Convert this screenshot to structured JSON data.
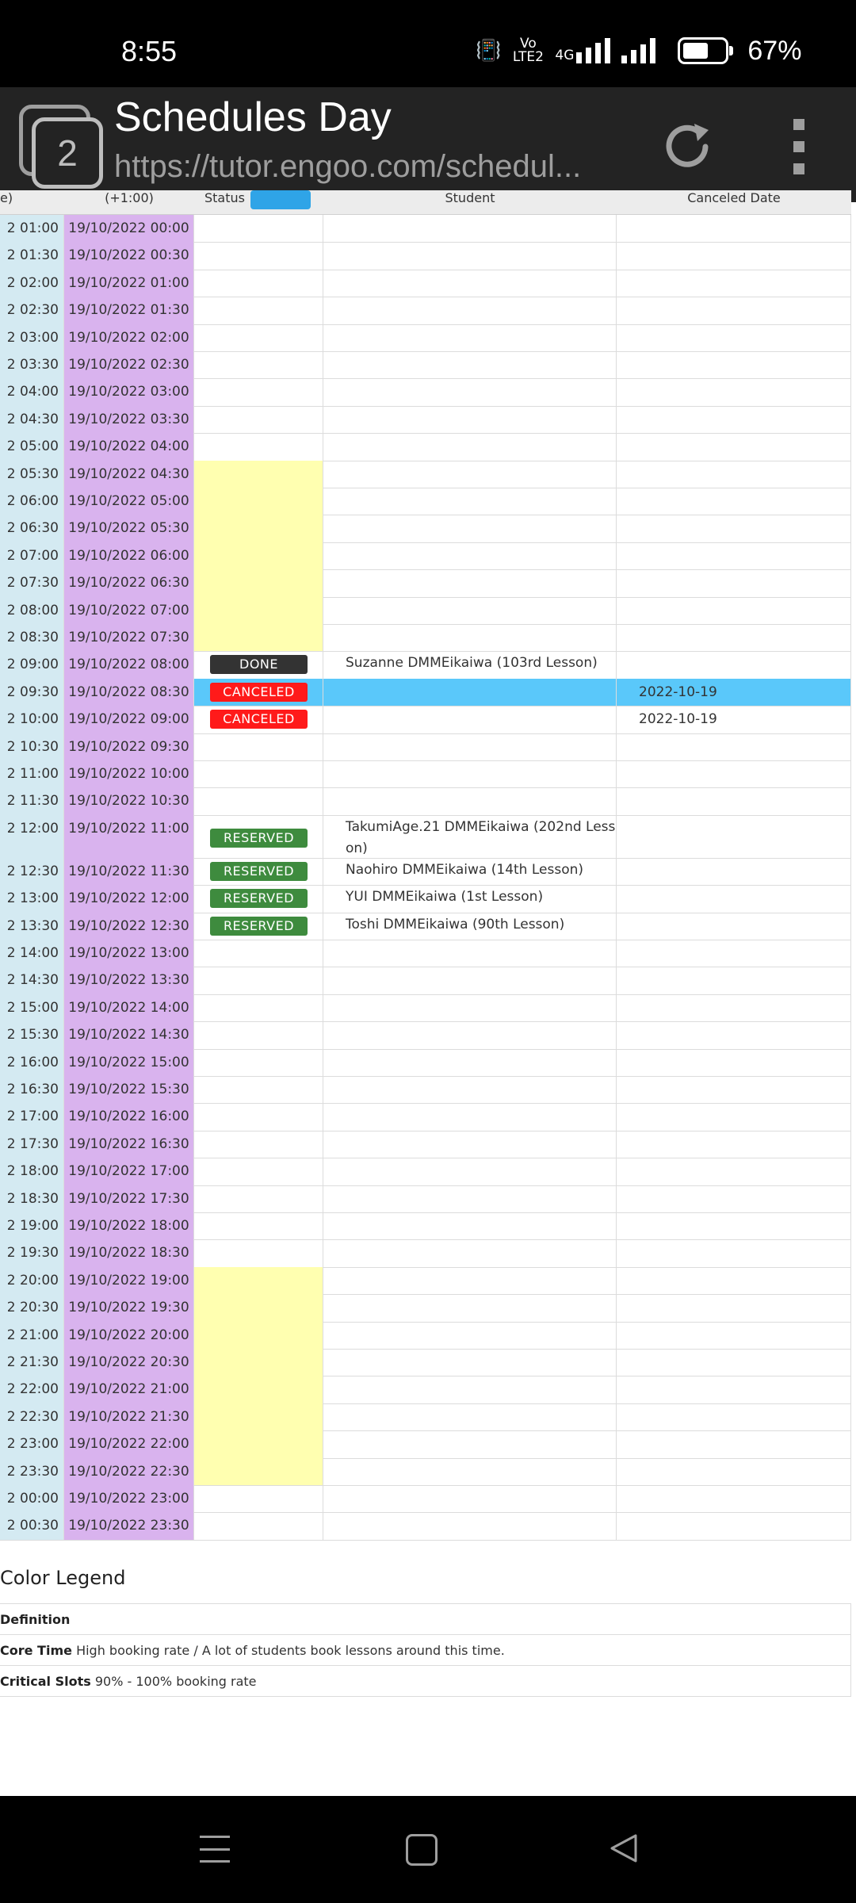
{
  "status_bar": {
    "time": "8:55",
    "volte": "Vo LTE2",
    "network": "4G",
    "battery": "67%",
    "battery_level": 0.67
  },
  "browser": {
    "tab_count": "2",
    "title": "Schedules Day",
    "url": "https://tutor.engoo.com/schedul..."
  },
  "table": {
    "headers": [
      "e)",
      "(+1:00)",
      "Status",
      "Student",
      "Canceled Date"
    ],
    "rows": [
      {
        "local": "2 01:00",
        "jst": "19/10/2022 00:00",
        "core": false,
        "status": "",
        "student": "",
        "canceled": "",
        "highlight": false
      },
      {
        "local": "2 01:30",
        "jst": "19/10/2022 00:30",
        "core": false,
        "status": "",
        "student": "",
        "canceled": "",
        "highlight": false
      },
      {
        "local": "2 02:00",
        "jst": "19/10/2022 01:00",
        "core": false,
        "status": "",
        "student": "",
        "canceled": "",
        "highlight": false
      },
      {
        "local": "2 02:30",
        "jst": "19/10/2022 01:30",
        "core": false,
        "status": "",
        "student": "",
        "canceled": "",
        "highlight": false
      },
      {
        "local": "2 03:00",
        "jst": "19/10/2022 02:00",
        "core": false,
        "status": "",
        "student": "",
        "canceled": "",
        "highlight": false
      },
      {
        "local": "2 03:30",
        "jst": "19/10/2022 02:30",
        "core": false,
        "status": "",
        "student": "",
        "canceled": "",
        "highlight": false
      },
      {
        "local": "2 04:00",
        "jst": "19/10/2022 03:00",
        "core": false,
        "status": "",
        "student": "",
        "canceled": "",
        "highlight": false
      },
      {
        "local": "2 04:30",
        "jst": "19/10/2022 03:30",
        "core": false,
        "status": "",
        "student": "",
        "canceled": "",
        "highlight": false
      },
      {
        "local": "2 05:00",
        "jst": "19/10/2022 04:00",
        "core": false,
        "status": "",
        "student": "",
        "canceled": "",
        "highlight": false
      },
      {
        "local": "2 05:30",
        "jst": "19/10/2022 04:30",
        "core": true,
        "status": "",
        "student": "",
        "canceled": "",
        "highlight": false
      },
      {
        "local": "2 06:00",
        "jst": "19/10/2022 05:00",
        "core": true,
        "status": "",
        "student": "",
        "canceled": "",
        "highlight": false
      },
      {
        "local": "2 06:30",
        "jst": "19/10/2022 05:30",
        "core": true,
        "status": "",
        "student": "",
        "canceled": "",
        "highlight": false
      },
      {
        "local": "2 07:00",
        "jst": "19/10/2022 06:00",
        "core": true,
        "status": "",
        "student": "",
        "canceled": "",
        "highlight": false
      },
      {
        "local": "2 07:30",
        "jst": "19/10/2022 06:30",
        "core": true,
        "status": "",
        "student": "",
        "canceled": "",
        "highlight": false
      },
      {
        "local": "2 08:00",
        "jst": "19/10/2022 07:00",
        "core": true,
        "status": "",
        "student": "",
        "canceled": "",
        "highlight": false
      },
      {
        "local": "2 08:30",
        "jst": "19/10/2022 07:30",
        "core": true,
        "status": "",
        "student": "",
        "canceled": "",
        "highlight": false
      },
      {
        "local": "2 09:00",
        "jst": "19/10/2022 08:00",
        "core": false,
        "status": "DONE",
        "student": "Suzanne DMMEikaiwa (103rd Lesson)",
        "canceled": "",
        "highlight": false
      },
      {
        "local": "2 09:30",
        "jst": "19/10/2022 08:30",
        "core": false,
        "status": "CANCELED",
        "student": "",
        "canceled": "2022-10-19",
        "highlight": true
      },
      {
        "local": "2 10:00",
        "jst": "19/10/2022 09:00",
        "core": false,
        "status": "CANCELED",
        "student": "",
        "canceled": "2022-10-19",
        "highlight": false
      },
      {
        "local": "2 10:30",
        "jst": "19/10/2022 09:30",
        "core": false,
        "status": "",
        "student": "",
        "canceled": "",
        "highlight": false
      },
      {
        "local": "2 11:00",
        "jst": "19/10/2022 10:00",
        "core": false,
        "status": "",
        "student": "",
        "canceled": "",
        "highlight": false
      },
      {
        "local": "2 11:30",
        "jst": "19/10/2022 10:30",
        "core": false,
        "status": "",
        "student": "",
        "canceled": "",
        "highlight": false
      },
      {
        "local": "2 12:00",
        "jst": "19/10/2022 11:00",
        "core": false,
        "status": "RESERVED",
        "student": "TakumiAge.21 DMMEikaiwa (202nd Lesson)",
        "canceled": "",
        "highlight": false,
        "tall": true
      },
      {
        "local": "2 12:30",
        "jst": "19/10/2022 11:30",
        "core": false,
        "status": "RESERVED",
        "student": "Naohiro DMMEikaiwa (14th Lesson)",
        "canceled": "",
        "highlight": false
      },
      {
        "local": "2 13:00",
        "jst": "19/10/2022 12:00",
        "core": false,
        "status": "RESERVED",
        "student": "YUI DMMEikaiwa (1st Lesson)",
        "canceled": "",
        "highlight": false
      },
      {
        "local": "2 13:30",
        "jst": "19/10/2022 12:30",
        "core": false,
        "status": "RESERVED",
        "student": "Toshi DMMEikaiwa (90th Lesson)",
        "canceled": "",
        "highlight": false
      },
      {
        "local": "2 14:00",
        "jst": "19/10/2022 13:00",
        "core": false,
        "status": "",
        "student": "",
        "canceled": "",
        "highlight": false
      },
      {
        "local": "2 14:30",
        "jst": "19/10/2022 13:30",
        "core": false,
        "status": "",
        "student": "",
        "canceled": "",
        "highlight": false
      },
      {
        "local": "2 15:00",
        "jst": "19/10/2022 14:00",
        "core": false,
        "status": "",
        "student": "",
        "canceled": "",
        "highlight": false
      },
      {
        "local": "2 15:30",
        "jst": "19/10/2022 14:30",
        "core": false,
        "status": "",
        "student": "",
        "canceled": "",
        "highlight": false
      },
      {
        "local": "2 16:00",
        "jst": "19/10/2022 15:00",
        "core": false,
        "status": "",
        "student": "",
        "canceled": "",
        "highlight": false
      },
      {
        "local": "2 16:30",
        "jst": "19/10/2022 15:30",
        "core": false,
        "status": "",
        "student": "",
        "canceled": "",
        "highlight": false
      },
      {
        "local": "2 17:00",
        "jst": "19/10/2022 16:00",
        "core": false,
        "status": "",
        "student": "",
        "canceled": "",
        "highlight": false
      },
      {
        "local": "2 17:30",
        "jst": "19/10/2022 16:30",
        "core": false,
        "status": "",
        "student": "",
        "canceled": "",
        "highlight": false
      },
      {
        "local": "2 18:00",
        "jst": "19/10/2022 17:00",
        "core": false,
        "status": "",
        "student": "",
        "canceled": "",
        "highlight": false
      },
      {
        "local": "2 18:30",
        "jst": "19/10/2022 17:30",
        "core": false,
        "status": "",
        "student": "",
        "canceled": "",
        "highlight": false
      },
      {
        "local": "2 19:00",
        "jst": "19/10/2022 18:00",
        "core": false,
        "status": "",
        "student": "",
        "canceled": "",
        "highlight": false
      },
      {
        "local": "2 19:30",
        "jst": "19/10/2022 18:30",
        "core": false,
        "status": "",
        "student": "",
        "canceled": "",
        "highlight": false
      },
      {
        "local": "2 20:00",
        "jst": "19/10/2022 19:00",
        "core": true,
        "status": "",
        "student": "",
        "canceled": "",
        "highlight": false
      },
      {
        "local": "2 20:30",
        "jst": "19/10/2022 19:30",
        "core": true,
        "status": "",
        "student": "",
        "canceled": "",
        "highlight": false
      },
      {
        "local": "2 21:00",
        "jst": "19/10/2022 20:00",
        "core": true,
        "status": "",
        "student": "",
        "canceled": "",
        "highlight": false
      },
      {
        "local": "2 21:30",
        "jst": "19/10/2022 20:30",
        "core": true,
        "status": "",
        "student": "",
        "canceled": "",
        "highlight": false
      },
      {
        "local": "2 22:00",
        "jst": "19/10/2022 21:00",
        "core": true,
        "status": "",
        "student": "",
        "canceled": "",
        "highlight": false
      },
      {
        "local": "2 22:30",
        "jst": "19/10/2022 21:30",
        "core": true,
        "status": "",
        "student": "",
        "canceled": "",
        "highlight": false
      },
      {
        "local": "2 23:00",
        "jst": "19/10/2022 22:00",
        "core": true,
        "status": "",
        "student": "",
        "canceled": "",
        "highlight": false
      },
      {
        "local": "2 23:30",
        "jst": "19/10/2022 22:30",
        "core": true,
        "status": "",
        "student": "",
        "canceled": "",
        "highlight": false
      },
      {
        "local": "2 00:00",
        "jst": "19/10/2022 23:00",
        "core": false,
        "status": "",
        "student": "",
        "canceled": "",
        "highlight": false
      },
      {
        "local": "2 00:30",
        "jst": "19/10/2022 23:30",
        "core": false,
        "status": "",
        "student": "",
        "canceled": "",
        "highlight": false
      }
    ]
  },
  "legend": {
    "title": "Color Legend",
    "header": "Definition",
    "items": [
      {
        "term": "Core Time",
        "desc": "High booking rate / A lot of students book lessons around this time."
      },
      {
        "term": "Critical Slots",
        "desc": "90% - 100% booking rate"
      }
    ]
  },
  "colors": {
    "local_time_col": "#d4eaf2",
    "jst_col": "#d9b3ee",
    "core_time": "#ffffb0",
    "highlight_row": "#5ac8fa",
    "done": "#333333",
    "canceled": "#ff1a1a",
    "reserved": "#3e8b3e"
  }
}
